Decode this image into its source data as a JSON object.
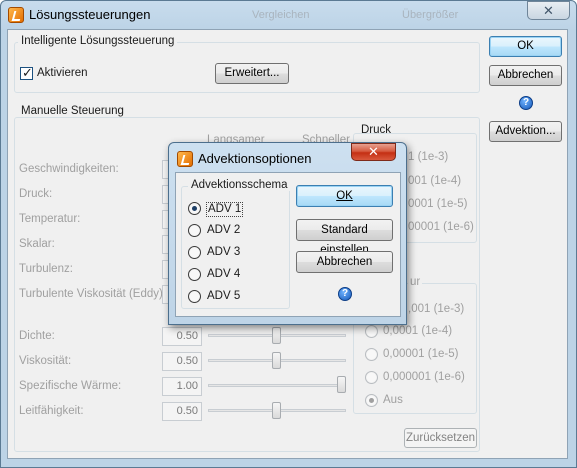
{
  "main_window": {
    "title": "Lösungssteuerungen",
    "close_glyph": "✕",
    "faded_tab_1": "Vergleichen",
    "faded_tab_2": "Übergrößer",
    "intelligent_group": {
      "title": "Intelligente Lösungssteuerung",
      "activate_label": "Aktivieren",
      "activate_checked": true,
      "extended_button": "Erweitert..."
    },
    "side_buttons": {
      "ok": "OK",
      "cancel": "Abbrechen",
      "help": "?",
      "advection": "Advektion..."
    },
    "manual_group": {
      "title": "Manuelle Steuerung",
      "slower_label": "Langsamer",
      "faster_label": "Schneller",
      "pressure_header": "Druck",
      "relaxation_rows": [
        {
          "label": "Geschwindigkeiten:"
        },
        {
          "label": "Druck:"
        },
        {
          "label": "Temperatur:"
        },
        {
          "label": "Skalar:"
        },
        {
          "label": "Turbulenz:"
        },
        {
          "label": "Turbulente Viskosität (Eddy):"
        }
      ],
      "pressure_options_visible": [
        "1 (1e-3)",
        "001 (1e-4)",
        "0001 (1e-5)",
        "00001 (1e-6)"
      ],
      "property_rows": [
        {
          "label": "Dichte:",
          "value": "0.50",
          "slider": 0.5
        },
        {
          "label": "Viskosität:",
          "value": "0.50",
          "slider": 0.5
        },
        {
          "label": "Spezifische Wärme:",
          "value": "1.00",
          "slider": 1.0
        },
        {
          "label": "Leitfähigkeit:",
          "value": "0.50",
          "slider": 0.5
        }
      ],
      "temperature_header_partial": "ur",
      "temperature_options": [
        {
          "label": "0,001 (1e-3)",
          "checked": false
        },
        {
          "label": "0,0001 (1e-4)",
          "checked": false
        },
        {
          "label": "0,00001 (1e-5)",
          "checked": false
        },
        {
          "label": "0,000001 (1e-6)",
          "checked": false
        },
        {
          "label": "Aus",
          "checked": true
        }
      ],
      "temperature_first_partial": ",001 (1e-3)",
      "reset_button": "Zurücksetzen"
    }
  },
  "advection_dialog": {
    "title": "Advektionsoptionen",
    "close_glyph": "✕",
    "scheme_group_title": "Advektionsschema",
    "schemes": [
      {
        "label": "ADV 1",
        "checked": true
      },
      {
        "label": "ADV 2",
        "checked": false
      },
      {
        "label": "ADV 3",
        "checked": false
      },
      {
        "label": "ADV 4",
        "checked": false
      },
      {
        "label": "ADV 5",
        "checked": false
      }
    ],
    "ok_button": "OK",
    "default_button": "Standard einstellen",
    "cancel_button": "Abbrechen",
    "help": "?"
  }
}
